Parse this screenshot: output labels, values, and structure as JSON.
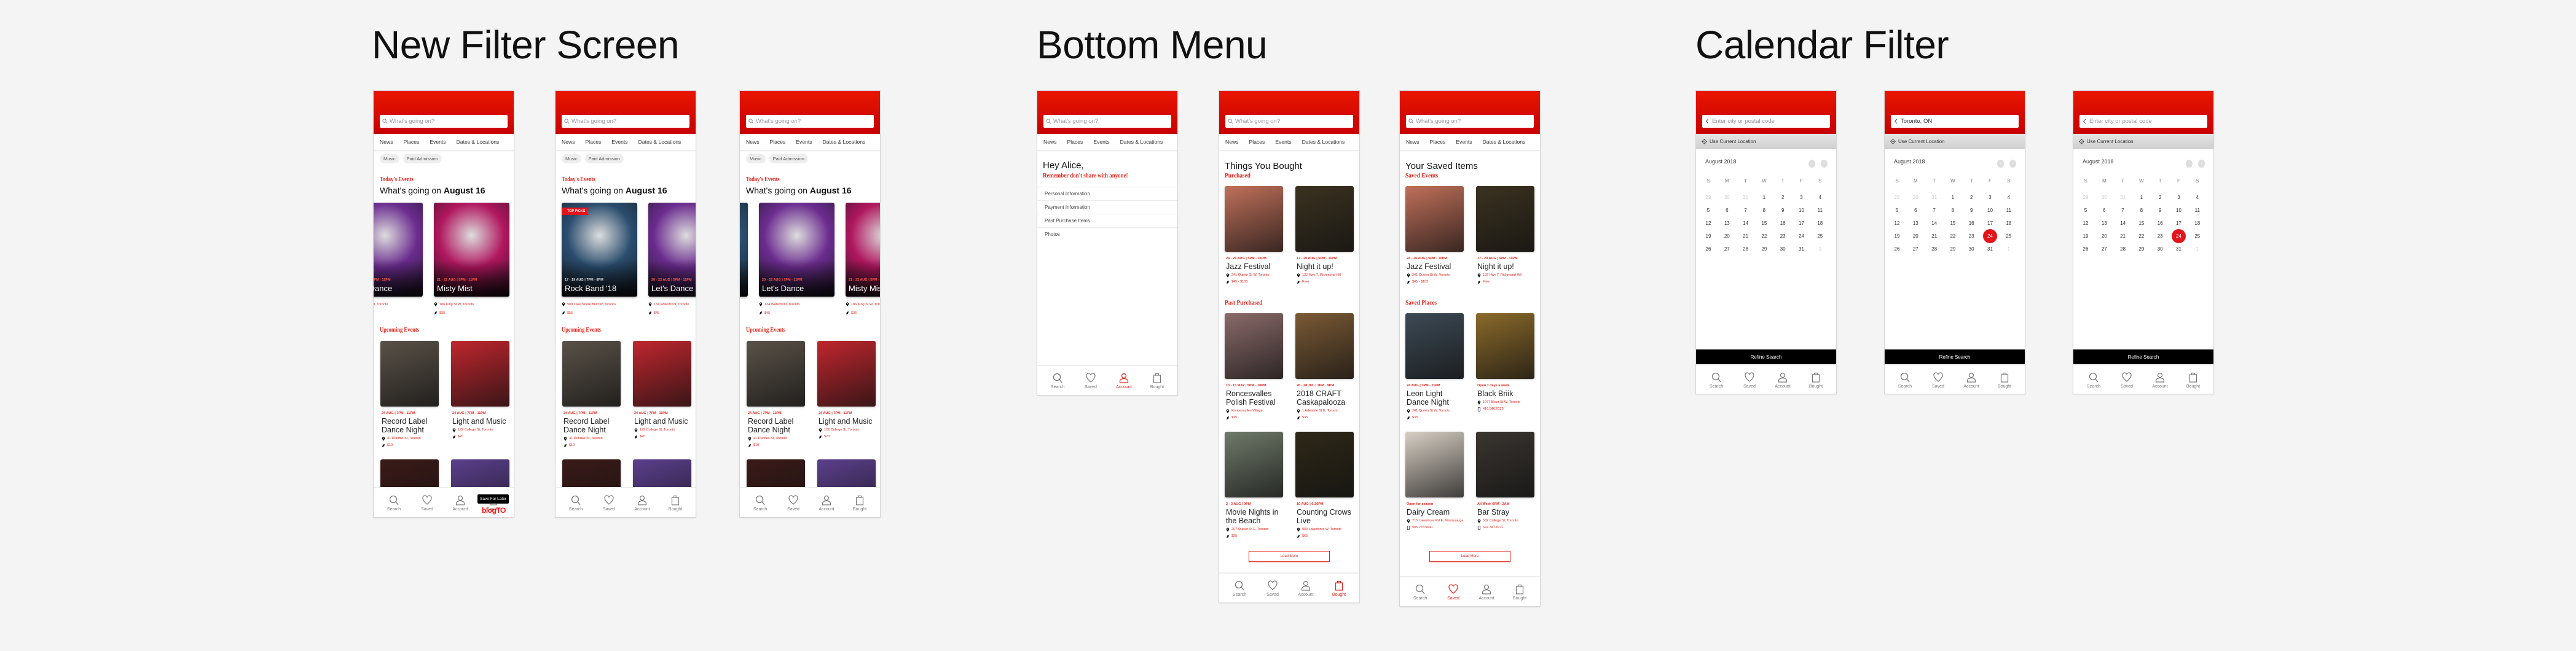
{
  "sections": [
    {
      "title": "New Filter Screen"
    },
    {
      "title": "Bottom Menu"
    },
    {
      "title": "Calendar Filter"
    }
  ],
  "colors": {
    "brand_red": "#e3141b",
    "header_top": "#e81600",
    "header_bottom": "#c70000",
    "background": "#f4f4f4"
  },
  "common": {
    "search_placeholder": "What's going on?",
    "nav_tabs": [
      "News",
      "Places",
      "Events",
      "Dates & Locations"
    ],
    "bottom_nav": [
      {
        "label": "Search",
        "icon": "search-icon"
      },
      {
        "label": "Saved",
        "icon": "heart-icon"
      },
      {
        "label": "Account",
        "icon": "user-icon"
      },
      {
        "label": "Bought",
        "icon": "shopping-bag-icon"
      }
    ]
  },
  "filter_screen": {
    "chips": [
      "Music",
      "Paid Admission"
    ],
    "today_label": "Today's Events",
    "heading_prefix": "What's going on",
    "heading_date": "August 16",
    "upcoming_label": "Upcoming Events",
    "today_events": [
      {
        "title": "Rock Band '18",
        "date": "17 - 19 AUG | 7PM - 8PM",
        "location": "909 Lake Shore Blvd W, Toronto",
        "price": "$55",
        "badge": "TOP PICKS",
        "thumb_color": "#2a4d6e"
      },
      {
        "title": "Let's Dance",
        "date": "20 - 22 AUG | 5PM - 11PM",
        "location": "134 Waterfront, Toronto",
        "price": "$45",
        "thumb_color": "#6b2c8f"
      },
      {
        "title": "Misty Mist",
        "date": "21 - 22 AUG | 5PM - 11PM",
        "location": "186 King St W, Toronto",
        "price": "$35",
        "thumb_color": "#b0175f"
      }
    ],
    "upcoming_events": [
      {
        "title": "Record Label Dance Night",
        "date": "24 AUG | 7PM - 11PM",
        "location": "41 Dundas St, Toronto",
        "price": "$10",
        "thumb_color": "#5a5248"
      },
      {
        "title": "Light and Music",
        "date": "24 AUG | 7PM - 11PM",
        "location": "122 College St, Toronto",
        "price": "$20",
        "thumb_color": "#c0262e"
      },
      {
        "title": "",
        "thumb_color": "#3a1a18"
      },
      {
        "title": "",
        "thumb_color": "#5b3f8c"
      }
    ],
    "screens": [
      {
        "tooltip": "Save For Later",
        "logo": "blogTO"
      },
      {},
      {}
    ]
  },
  "bottom_menu": {
    "account": {
      "active_tab": "Account",
      "greeting": "Hey Alice,",
      "warning": "Remember don't share with anyone!",
      "items": [
        "Personal Information",
        "Payment Information",
        "Past Purchase Items",
        "Photos"
      ]
    },
    "bought": {
      "active_tab": "Bought",
      "title": "Things You Bought",
      "groups": [
        {
          "label": "Purchased",
          "items": [
            {
              "title": "Jazz Festival",
              "date": "24 - 26 AUG | 5PM - 10PM",
              "location": "241 Queen St W, Toronto",
              "price": "$45 - $105",
              "thumb_color": "#c0705a"
            },
            {
              "title": "Night it up!",
              "date": "17 - 20 AUG | 5PM - 11PM",
              "location": "132 Hwy 7, Richmond Hill",
              "price": "Free",
              "thumb_color": "#3b3220"
            }
          ]
        },
        {
          "label": "Past Purchased",
          "items": [
            {
              "title": "Roncesvalles Polish Festival",
              "date": "13 - 15 MAY | 5PM - 10PM",
              "location": "Roncesvalles Village",
              "price": "$25",
              "thumb_color": "#8a6b6a"
            },
            {
              "title": "2018 CRAFT Caskapalooza",
              "date": "26 - 28 JUL | 1PM - 9PM",
              "location": "1 Adelaide St E, Toronto",
              "price": "$35",
              "thumb_color": "#7a5a35"
            },
            {
              "title": "Movie Nights in the Beach",
              "date": "2 - 3 AUG | 9PM",
              "location": "207 Queen St E, Toronto",
              "price": "$25",
              "thumb_color": "#6f7a6a"
            },
            {
              "title": "Counting Crows Live",
              "date": "10 AUG | 6:30PM",
              "location": "909 Lakeshore W, Toronto",
              "price": "$65",
              "thumb_color": "#2e2818"
            }
          ]
        }
      ],
      "load_more": "Load More"
    },
    "saved": {
      "active_tab": "Saved",
      "title": "Your Saved Items",
      "groups": [
        {
          "label": "Saved Events",
          "items": [
            {
              "title": "Jazz Festival",
              "date": "24 - 26 AUG | 5PM - 10PM",
              "location": "241 Queen St W, Toronto",
              "price": "$45 - $105",
              "thumb_color": "#c0705a"
            },
            {
              "title": "Night it up!",
              "date": "17 - 20 AUG | 5PM - 11PM",
              "location": "132 Hwy 7, Richmond Hill",
              "price": "Free",
              "thumb_color": "#3b3220"
            }
          ]
        },
        {
          "label": "Saved Places",
          "items": [
            {
              "title": "Leon Light Dance Night",
              "date": "24 AUG | 7PM - 11PM",
              "location": "241 Queen St W, Toronto",
              "price": "$35",
              "thumb_color": "#3d4a55"
            },
            {
              "title": "Black Briik",
              "date": "Open 7 days a week",
              "location": "1077 Bloor St W, Toronto",
              "phone": "416.546.6123",
              "thumb_color": "#8a6a2a"
            },
            {
              "title": "Dairy Cream",
              "date": "Open for season",
              "location": "715 Lakeshore Rd E, Mississauga",
              "phone": "905.278.5641",
              "thumb_color": "#d8cfc4"
            },
            {
              "title": "Bar Stray",
              "date": "All Week 6PM - 2AM",
              "location": "532 College St, Toronto",
              "phone": "647.347.8711",
              "thumb_color": "#3a3530"
            }
          ]
        }
      ],
      "load_more": "Load More"
    }
  },
  "calendar": {
    "placeholder": "Enter city or postal code",
    "use_location": "Use Current Location",
    "month": "August 2018",
    "weekdays": [
      "S",
      "M",
      "T",
      "W",
      "T",
      "F",
      "S"
    ],
    "weeks": [
      [
        "29",
        "30",
        "31",
        "1",
        "2",
        "3",
        "4"
      ],
      [
        "5",
        "6",
        "7",
        "8",
        "9",
        "10",
        "11"
      ],
      [
        "12",
        "13",
        "14",
        "15",
        "16",
        "17",
        "18"
      ],
      [
        "19",
        "20",
        "21",
        "22",
        "23",
        "24",
        "25"
      ],
      [
        "26",
        "27",
        "28",
        "29",
        "30",
        "31",
        "1"
      ]
    ],
    "refine": "Refine Search",
    "screens": [
      {
        "location_value": null,
        "selected_day": null
      },
      {
        "location_value": "Toronto, ON",
        "selected_day": 24
      },
      {
        "location_value": null,
        "selected_day": 24
      }
    ]
  }
}
